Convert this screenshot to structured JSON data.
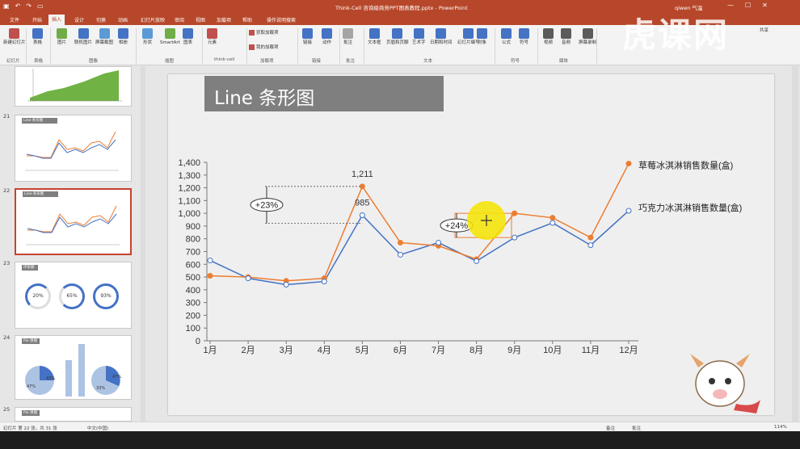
{
  "window": {
    "doc_title": "Think-Cell 咨询级商务PPT图表教程.pptx - PowerPoint",
    "user": "qiwen 气温",
    "watermark": "虎课网"
  },
  "tabs": [
    "文件",
    "开始",
    "插入",
    "设计",
    "切换",
    "动画",
    "幻灯片放映",
    "审阅",
    "视图",
    "加载项",
    "帮助",
    "操作说明搜索"
  ],
  "active_tab": "插入",
  "ribbon": {
    "buttons": [
      "新建幻灯片",
      "表格",
      "图片",
      "联机图片",
      "屏幕截图",
      "相册",
      "形状",
      "SmartArt",
      "图表",
      "元素",
      "获取加载项",
      "我的加载项",
      "链接",
      "动作",
      "批注",
      "文本框",
      "页眉和页脚",
      "艺术字",
      "日期和时间",
      "幻灯片编号",
      "对象",
      "公式",
      "符号",
      "视频",
      "音频",
      "屏幕录制"
    ],
    "groups": [
      "幻灯片",
      "表格",
      "图像",
      "插图",
      "think-cell",
      "加载项",
      "链接",
      "批注",
      "文本",
      "符号",
      "媒体"
    ],
    "share": "共享"
  },
  "thumbnails": [
    {
      "num": "21",
      "title": "Line 条形图"
    },
    {
      "num": "22",
      "title": "Line 条形图"
    },
    {
      "num": "23",
      "title": "环形图",
      "labels": [
        "20%",
        "65%",
        "93%"
      ]
    },
    {
      "num": "24",
      "title": "Pie 饼图",
      "labels": [
        "43%",
        "47%",
        "33%",
        "47%"
      ]
    },
    {
      "num": "25",
      "title": "Pie 饼图"
    }
  ],
  "slide": {
    "title": "Line 条形图"
  },
  "chart_data": {
    "type": "line",
    "categories": [
      "1月",
      "2月",
      "3月",
      "4月",
      "5月",
      "6月",
      "7月",
      "8月",
      "9月",
      "10月",
      "11月",
      "12月"
    ],
    "ylim": [
      0,
      1400
    ],
    "yticks": [
      "0",
      "100",
      "200",
      "300",
      "400",
      "500",
      "600",
      "700",
      "800",
      "900",
      "1,000",
      "1,100",
      "1,200",
      "1,300",
      "1,400"
    ],
    "series": [
      {
        "name": "草莓冰淇淋销售数量(盒)",
        "color": "#ed7d31",
        "values": [
          510,
          500,
          470,
          490,
          1211,
          770,
          745,
          640,
          1000,
          965,
          810,
          1390
        ]
      },
      {
        "name": "巧克力冰淇淋销售数量(盒)",
        "color": "#4472c4",
        "values": [
          630,
          490,
          440,
          465,
          985,
          675,
          770,
          625,
          810,
          925,
          750,
          1020
        ]
      }
    ],
    "data_labels": [
      "1,211",
      "985"
    ],
    "annotations": [
      "+23%",
      "+24%"
    ]
  },
  "status": {
    "slide_info": "幻灯片 第 22 张，共 31 张",
    "lang": "中文(中国)",
    "notes": "备注",
    "comments": "批注",
    "zoom": "114%"
  }
}
